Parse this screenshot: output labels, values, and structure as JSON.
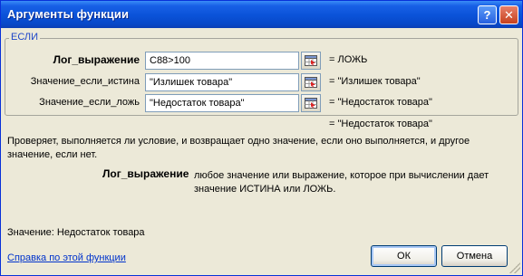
{
  "window": {
    "title": "Аргументы функции",
    "help_glyph": "?",
    "close_glyph": "✕"
  },
  "function_name": "ЕСЛИ",
  "arguments": [
    {
      "label": "Лог_выражение",
      "value": "C88>100",
      "result": "=  ЛОЖЬ"
    },
    {
      "label": "Значение_если_истина",
      "value": "\"Излишек товара\"",
      "result": "=  \"Излишек товара\""
    },
    {
      "label": "Значение_если_ложь",
      "value": "\"Недостаток товара\"",
      "result": "=  \"Недостаток товара\""
    }
  ],
  "overall_result": "=  \"Недостаток товара\"",
  "description": "Проверяет, выполняется ли условие, и возвращает одно значение, если оно выполняется, и другое значение, если нет.",
  "argument_help": {
    "name": "Лог_выражение",
    "text": "любое значение или выражение, которое при вычислении дает значение ИСТИНА или ЛОЖЬ."
  },
  "value_line": "Значение:   Недостаток товара",
  "help_link": "Справка по этой функции",
  "buttons": {
    "ok": "ОК",
    "cancel": "Отмена"
  },
  "colors": {
    "titlebar": "#0a52d8",
    "dialog_bg": "#ece9d8",
    "legend_text": "#1e46c8",
    "link": "#0033cc"
  },
  "icons": [
    "help-icon",
    "close-icon",
    "range-select-icon",
    "resize-grip-icon"
  ]
}
